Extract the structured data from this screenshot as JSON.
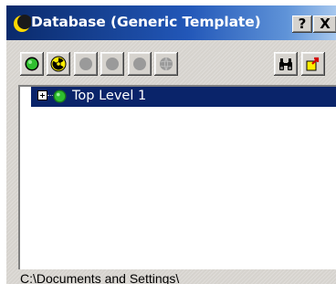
{
  "window": {
    "title": "Database (Generic Template)",
    "help_label": "?",
    "close_label": "X"
  },
  "toolbar": {
    "buttons": [
      {
        "icon": "green-circle-icon",
        "enabled": true
      },
      {
        "icon": "radiation-icon",
        "enabled": true
      },
      {
        "icon": "gray-circle-icon",
        "enabled": false
      },
      {
        "icon": "gray-circle-icon",
        "enabled": false
      },
      {
        "icon": "gray-circle-icon",
        "enabled": false
      },
      {
        "icon": "gray-sphere-icon",
        "enabled": false
      },
      {
        "icon": "binoculars-icon",
        "enabled": true
      },
      {
        "icon": "export-icon",
        "enabled": true
      }
    ]
  },
  "tree": {
    "nodes": [
      {
        "label": "Top Level 1",
        "selected": true,
        "expander": "+",
        "icon": "green-circle-icon"
      }
    ]
  },
  "status": {
    "path": "C:\\Documents and Settings\\"
  },
  "colors": {
    "title_dark": "#0a2a6b",
    "title_light": "#a6c7ee",
    "selection": "#0a246a",
    "face": "#d6d3ce",
    "green": "#2fbf2f",
    "yellow": "#ffee00"
  }
}
